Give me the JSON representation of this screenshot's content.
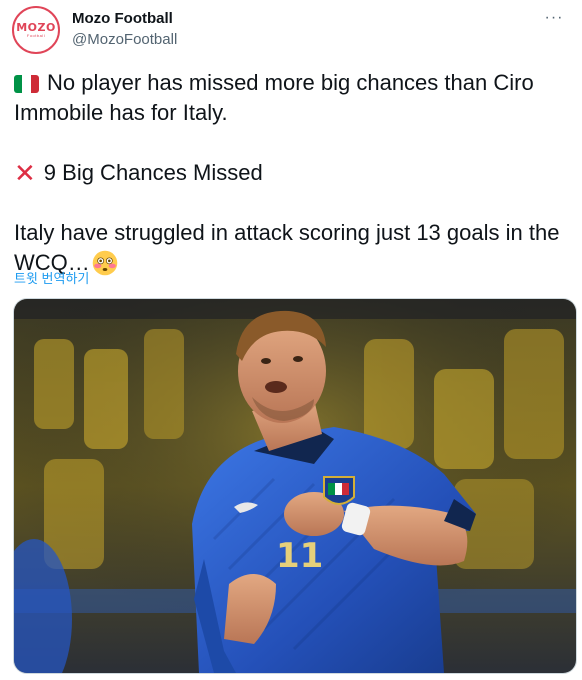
{
  "author": {
    "name": "Mozo Football",
    "handle": "@MozoFootball",
    "avatar_text": "MOZO",
    "avatar_subtext": "Football",
    "brand_color": "#e04558"
  },
  "tweet": {
    "line1_icon": "italy-flag",
    "line1": "No player has missed more big chances than Ciro Immobile has for Italy.",
    "line2_icon": "cross-mark",
    "line2": "9 Big Chances Missed",
    "line3": "Italy have struggled in attack scoring just 13 goals in the WCQ…",
    "line3_icon": "flushed-face",
    "translate_label": "트윗 번역하기"
  },
  "media": {
    "jersey_number": "11"
  },
  "colors": {
    "text": "#0f1419",
    "secondary": "#536471",
    "link": "#1d9bf0",
    "italy_blue": "#2a5bd0"
  }
}
